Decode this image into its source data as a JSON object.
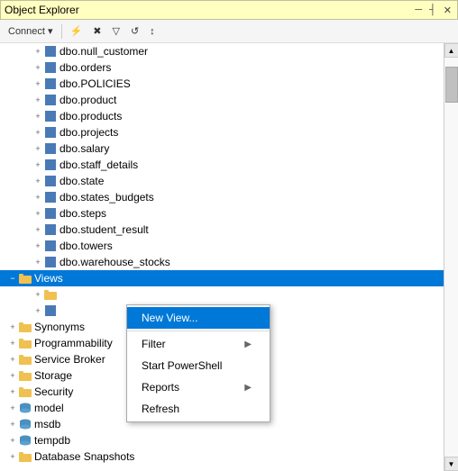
{
  "titleBar": {
    "title": "Object Explorer",
    "pin": "─",
    "close": "✕",
    "autoHide": "┤"
  },
  "toolbar": {
    "connect": "Connect ▾",
    "icon1": "⚡",
    "icon2": "✖",
    "icon3": "▩",
    "icon4": "▽",
    "icon5": "↺",
    "icon6": "↕"
  },
  "treeItems": [
    {
      "indent": 1,
      "type": "table",
      "label": "dbo.null_customer",
      "expand": "+"
    },
    {
      "indent": 1,
      "type": "table",
      "label": "dbo.orders",
      "expand": "+"
    },
    {
      "indent": 1,
      "type": "table",
      "label": "dbo.POLICIES",
      "expand": "+"
    },
    {
      "indent": 1,
      "type": "table",
      "label": "dbo.product",
      "expand": "+"
    },
    {
      "indent": 1,
      "type": "table",
      "label": "dbo.products",
      "expand": "+"
    },
    {
      "indent": 1,
      "type": "table",
      "label": "dbo.projects",
      "expand": "+"
    },
    {
      "indent": 1,
      "type": "table",
      "label": "dbo.salary",
      "expand": "+"
    },
    {
      "indent": 1,
      "type": "table",
      "label": "dbo.staff_details",
      "expand": "+"
    },
    {
      "indent": 1,
      "type": "table",
      "label": "dbo.state",
      "expand": "+"
    },
    {
      "indent": 1,
      "type": "table",
      "label": "dbo.states_budgets",
      "expand": "+"
    },
    {
      "indent": 1,
      "type": "table",
      "label": "dbo.steps",
      "expand": "+"
    },
    {
      "indent": 1,
      "type": "table",
      "label": "dbo.student_result",
      "expand": "+"
    },
    {
      "indent": 1,
      "type": "table",
      "label": "dbo.towers",
      "expand": "+"
    },
    {
      "indent": 1,
      "type": "table",
      "label": "dbo.warehouse_stocks",
      "expand": "+"
    },
    {
      "indent": 0,
      "type": "folder",
      "label": "Views",
      "expand": "-",
      "selected": true
    },
    {
      "indent": 1,
      "type": "folder",
      "label": "",
      "expand": "+"
    },
    {
      "indent": 1,
      "type": "table",
      "label": "",
      "expand": "+"
    },
    {
      "indent": 0,
      "type": "folder",
      "label": "Synonyms",
      "expand": "+"
    },
    {
      "indent": 0,
      "type": "folder",
      "label": "Programmability",
      "expand": "+"
    },
    {
      "indent": 0,
      "type": "folder",
      "label": "Service Broker",
      "expand": "+"
    },
    {
      "indent": 0,
      "type": "folder",
      "label": "Storage",
      "expand": "+"
    },
    {
      "indent": 0,
      "type": "folder",
      "label": "Security",
      "expand": "+"
    }
  ],
  "bottomItems": [
    {
      "type": "db",
      "label": "model",
      "expand": "+"
    },
    {
      "type": "db",
      "label": "msdb",
      "expand": "+"
    },
    {
      "type": "db",
      "label": "tempdb",
      "expand": "+"
    },
    {
      "type": "folder",
      "label": "Database Snapshots",
      "expand": "+"
    }
  ],
  "contextMenu": {
    "items": [
      {
        "label": "New View...",
        "arrow": false,
        "highlighted": true
      },
      {
        "separator": true
      },
      {
        "label": "Filter",
        "arrow": true
      },
      {
        "separator": false
      },
      {
        "label": "Start PowerShell",
        "arrow": false
      },
      {
        "separator": false
      },
      {
        "label": "Reports",
        "arrow": true,
        "highlighted": false
      },
      {
        "separator": false
      },
      {
        "label": "Refresh",
        "arrow": false
      }
    ]
  }
}
